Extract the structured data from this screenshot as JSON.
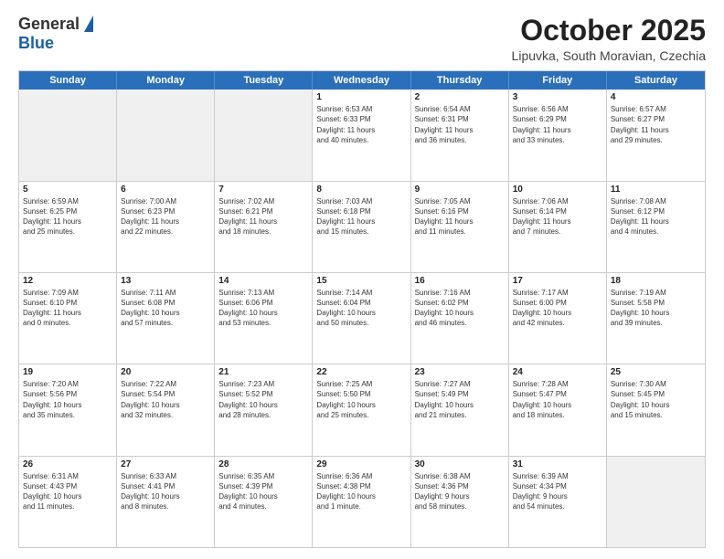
{
  "header": {
    "logo_general": "General",
    "logo_blue": "Blue",
    "month_title": "October 2025",
    "subtitle": "Lipuvka, South Moravian, Czechia"
  },
  "days_of_week": [
    "Sunday",
    "Monday",
    "Tuesday",
    "Wednesday",
    "Thursday",
    "Friday",
    "Saturday"
  ],
  "weeks": [
    [
      {
        "day": "",
        "info": ""
      },
      {
        "day": "",
        "info": ""
      },
      {
        "day": "",
        "info": ""
      },
      {
        "day": "1",
        "info": "Sunrise: 6:53 AM\nSunset: 6:33 PM\nDaylight: 11 hours\nand 40 minutes."
      },
      {
        "day": "2",
        "info": "Sunrise: 6:54 AM\nSunset: 6:31 PM\nDaylight: 11 hours\nand 36 minutes."
      },
      {
        "day": "3",
        "info": "Sunrise: 6:56 AM\nSunset: 6:29 PM\nDaylight: 11 hours\nand 33 minutes."
      },
      {
        "day": "4",
        "info": "Sunrise: 6:57 AM\nSunset: 6:27 PM\nDaylight: 11 hours\nand 29 minutes."
      }
    ],
    [
      {
        "day": "5",
        "info": "Sunrise: 6:59 AM\nSunset: 6:25 PM\nDaylight: 11 hours\nand 25 minutes."
      },
      {
        "day": "6",
        "info": "Sunrise: 7:00 AM\nSunset: 6:23 PM\nDaylight: 11 hours\nand 22 minutes."
      },
      {
        "day": "7",
        "info": "Sunrise: 7:02 AM\nSunset: 6:21 PM\nDaylight: 11 hours\nand 18 minutes."
      },
      {
        "day": "8",
        "info": "Sunrise: 7:03 AM\nSunset: 6:18 PM\nDaylight: 11 hours\nand 15 minutes."
      },
      {
        "day": "9",
        "info": "Sunrise: 7:05 AM\nSunset: 6:16 PM\nDaylight: 11 hours\nand 11 minutes."
      },
      {
        "day": "10",
        "info": "Sunrise: 7:06 AM\nSunset: 6:14 PM\nDaylight: 11 hours\nand 7 minutes."
      },
      {
        "day": "11",
        "info": "Sunrise: 7:08 AM\nSunset: 6:12 PM\nDaylight: 11 hours\nand 4 minutes."
      }
    ],
    [
      {
        "day": "12",
        "info": "Sunrise: 7:09 AM\nSunset: 6:10 PM\nDaylight: 11 hours\nand 0 minutes."
      },
      {
        "day": "13",
        "info": "Sunrise: 7:11 AM\nSunset: 6:08 PM\nDaylight: 10 hours\nand 57 minutes."
      },
      {
        "day": "14",
        "info": "Sunrise: 7:13 AM\nSunset: 6:06 PM\nDaylight: 10 hours\nand 53 minutes."
      },
      {
        "day": "15",
        "info": "Sunrise: 7:14 AM\nSunset: 6:04 PM\nDaylight: 10 hours\nand 50 minutes."
      },
      {
        "day": "16",
        "info": "Sunrise: 7:16 AM\nSunset: 6:02 PM\nDaylight: 10 hours\nand 46 minutes."
      },
      {
        "day": "17",
        "info": "Sunrise: 7:17 AM\nSunset: 6:00 PM\nDaylight: 10 hours\nand 42 minutes."
      },
      {
        "day": "18",
        "info": "Sunrise: 7:19 AM\nSunset: 5:58 PM\nDaylight: 10 hours\nand 39 minutes."
      }
    ],
    [
      {
        "day": "19",
        "info": "Sunrise: 7:20 AM\nSunset: 5:56 PM\nDaylight: 10 hours\nand 35 minutes."
      },
      {
        "day": "20",
        "info": "Sunrise: 7:22 AM\nSunset: 5:54 PM\nDaylight: 10 hours\nand 32 minutes."
      },
      {
        "day": "21",
        "info": "Sunrise: 7:23 AM\nSunset: 5:52 PM\nDaylight: 10 hours\nand 28 minutes."
      },
      {
        "day": "22",
        "info": "Sunrise: 7:25 AM\nSunset: 5:50 PM\nDaylight: 10 hours\nand 25 minutes."
      },
      {
        "day": "23",
        "info": "Sunrise: 7:27 AM\nSunset: 5:49 PM\nDaylight: 10 hours\nand 21 minutes."
      },
      {
        "day": "24",
        "info": "Sunrise: 7:28 AM\nSunset: 5:47 PM\nDaylight: 10 hours\nand 18 minutes."
      },
      {
        "day": "25",
        "info": "Sunrise: 7:30 AM\nSunset: 5:45 PM\nDaylight: 10 hours\nand 15 minutes."
      }
    ],
    [
      {
        "day": "26",
        "info": "Sunrise: 6:31 AM\nSunset: 4:43 PM\nDaylight: 10 hours\nand 11 minutes."
      },
      {
        "day": "27",
        "info": "Sunrise: 6:33 AM\nSunset: 4:41 PM\nDaylight: 10 hours\nand 8 minutes."
      },
      {
        "day": "28",
        "info": "Sunrise: 6:35 AM\nSunset: 4:39 PM\nDaylight: 10 hours\nand 4 minutes."
      },
      {
        "day": "29",
        "info": "Sunrise: 6:36 AM\nSunset: 4:38 PM\nDaylight: 10 hours\nand 1 minute."
      },
      {
        "day": "30",
        "info": "Sunrise: 6:38 AM\nSunset: 4:36 PM\nDaylight: 9 hours\nand 58 minutes."
      },
      {
        "day": "31",
        "info": "Sunrise: 6:39 AM\nSunset: 4:34 PM\nDaylight: 9 hours\nand 54 minutes."
      },
      {
        "day": "",
        "info": ""
      }
    ]
  ],
  "empty_first": [
    true,
    true,
    true,
    false,
    false,
    false,
    false
  ],
  "empty_last": [
    false,
    false,
    false,
    false,
    false,
    false,
    true
  ]
}
